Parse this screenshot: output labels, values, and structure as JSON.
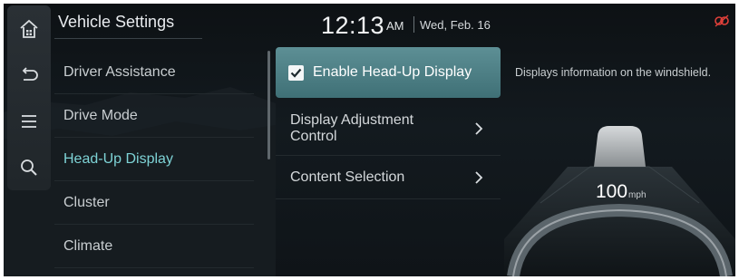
{
  "header": {
    "title": "Vehicle Settings",
    "time": "12:13",
    "ampm": "AM",
    "date": "Wed, Feb. 16"
  },
  "rail": {
    "icons": [
      "home-icon",
      "back-icon",
      "menu-icon",
      "search-icon"
    ]
  },
  "menu": {
    "items": [
      {
        "label": "Driver Assistance",
        "active": false
      },
      {
        "label": "Drive Mode",
        "active": false
      },
      {
        "label": "Head-Up Display",
        "active": true
      },
      {
        "label": "Cluster",
        "active": false
      },
      {
        "label": "Climate",
        "active": false
      }
    ]
  },
  "submenu": {
    "enable_hud": {
      "label": "Enable Head-Up Display",
      "checked": true
    },
    "display_adjustment": {
      "label_line1": "Display Adjustment",
      "label_line2": "Control"
    },
    "content_selection": {
      "label": "Content Selection"
    }
  },
  "panel": {
    "description": "Displays information on the windshield.",
    "speed_value": "100",
    "speed_unit": "mph"
  },
  "colors": {
    "accent": "#7ed3d6",
    "selected_bg": "#4f8389",
    "status_icon": "#e0403a"
  }
}
